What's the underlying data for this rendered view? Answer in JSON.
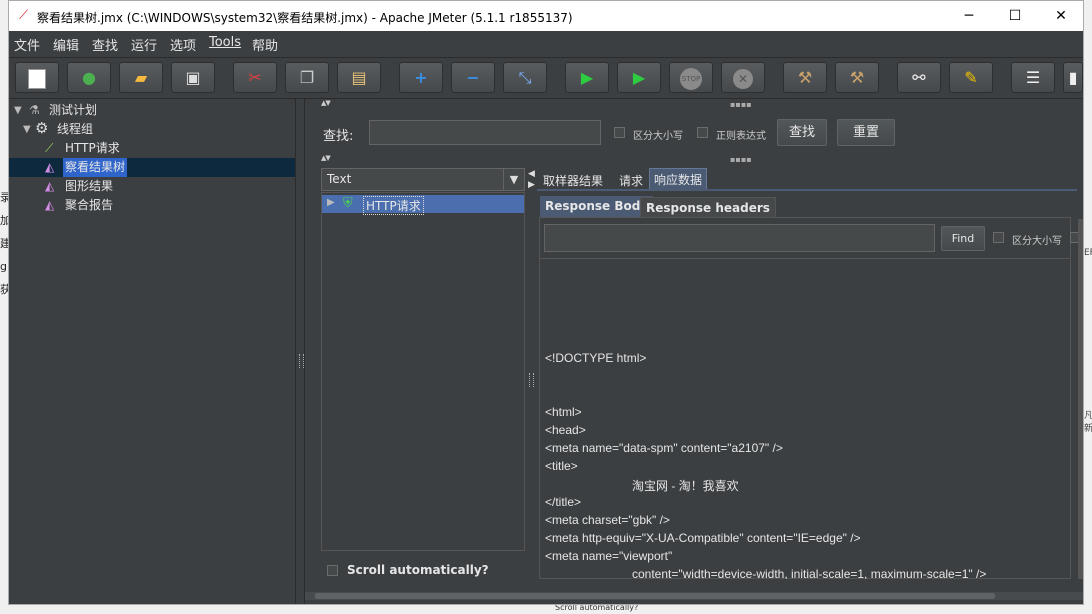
{
  "window": {
    "title": "察看结果树.jmx (C:\\WINDOWS\\system32\\察看结果树.jmx) - Apache JMeter (5.1.1 r1855137)",
    "minimize": "─",
    "maximize": "☐",
    "close": "✕"
  },
  "menu": [
    "文件",
    "编辑",
    "查找",
    "运行",
    "选项",
    "Tools",
    "帮助"
  ],
  "toolbar": {
    "icons": [
      "new-icon",
      "templates-icon",
      "open-icon",
      "save-icon",
      "cut-icon",
      "copy-icon",
      "paste-icon",
      "expand-icon",
      "collapse-icon",
      "toggle-icon",
      "start-icon",
      "start-no-pause-icon",
      "stop-icon",
      "shutdown-icon",
      "clear-icon",
      "clear-all-icon",
      "search-icon",
      "reset-search-icon",
      "function-helper-icon",
      "help-icon"
    ],
    "stop_text": "STOP"
  },
  "tree": {
    "items": [
      {
        "label": "测试计划",
        "icon": "test-plan-icon"
      },
      {
        "label": "线程组",
        "icon": "thread-group-icon"
      },
      {
        "label": "HTTP请求",
        "icon": "http-sampler-icon"
      },
      {
        "label": "察看结果树",
        "icon": "listener-icon"
      },
      {
        "label": "图形结果",
        "icon": "listener-icon"
      },
      {
        "label": "聚合报告",
        "icon": "listener-icon"
      }
    ]
  },
  "search": {
    "label": "查找:",
    "value": "",
    "case_label": "区分大小写",
    "regex_label": "正则表达式",
    "search_button": "查找",
    "reset_button": "重置"
  },
  "results": {
    "renderer": "Text",
    "items": [
      {
        "label": "HTTP请求",
        "status": "success"
      }
    ],
    "scroll_label": "Scroll automatically?"
  },
  "tabs": [
    "取样器结果",
    "请求",
    "响应数据"
  ],
  "active_tab": "响应数据",
  "subtabs": [
    "Response Body",
    "Response headers"
  ],
  "active_subtab": "Response Body",
  "find": {
    "value": "",
    "button": "Find",
    "case_label": "区分大小写"
  },
  "response_lines": [
    "<!DOCTYPE html>",
    "<html>",
    "<head>",
    "<meta name=\"data-spm\" content=\"a2107\" />",
    "<title>",
    "淘宝网 - 淘！我喜欢",
    "</title>",
    "<meta charset=\"gbk\" />",
    "<meta http-equiv=\"X-UA-Compatible\" content=\"IE=edge\" />",
    "<meta name=\"viewport\"",
    "content=\"width=device-width, initial-scale=1, maximum-scale=1\" />"
  ],
  "background": {
    "left_fragments": [
      "录",
      "加",
      "建",
      "g",
      "获"
    ],
    "right_fragments": [
      "ER",
      "凡",
      "新"
    ],
    "bottom_text": "Scroll automatically?"
  }
}
